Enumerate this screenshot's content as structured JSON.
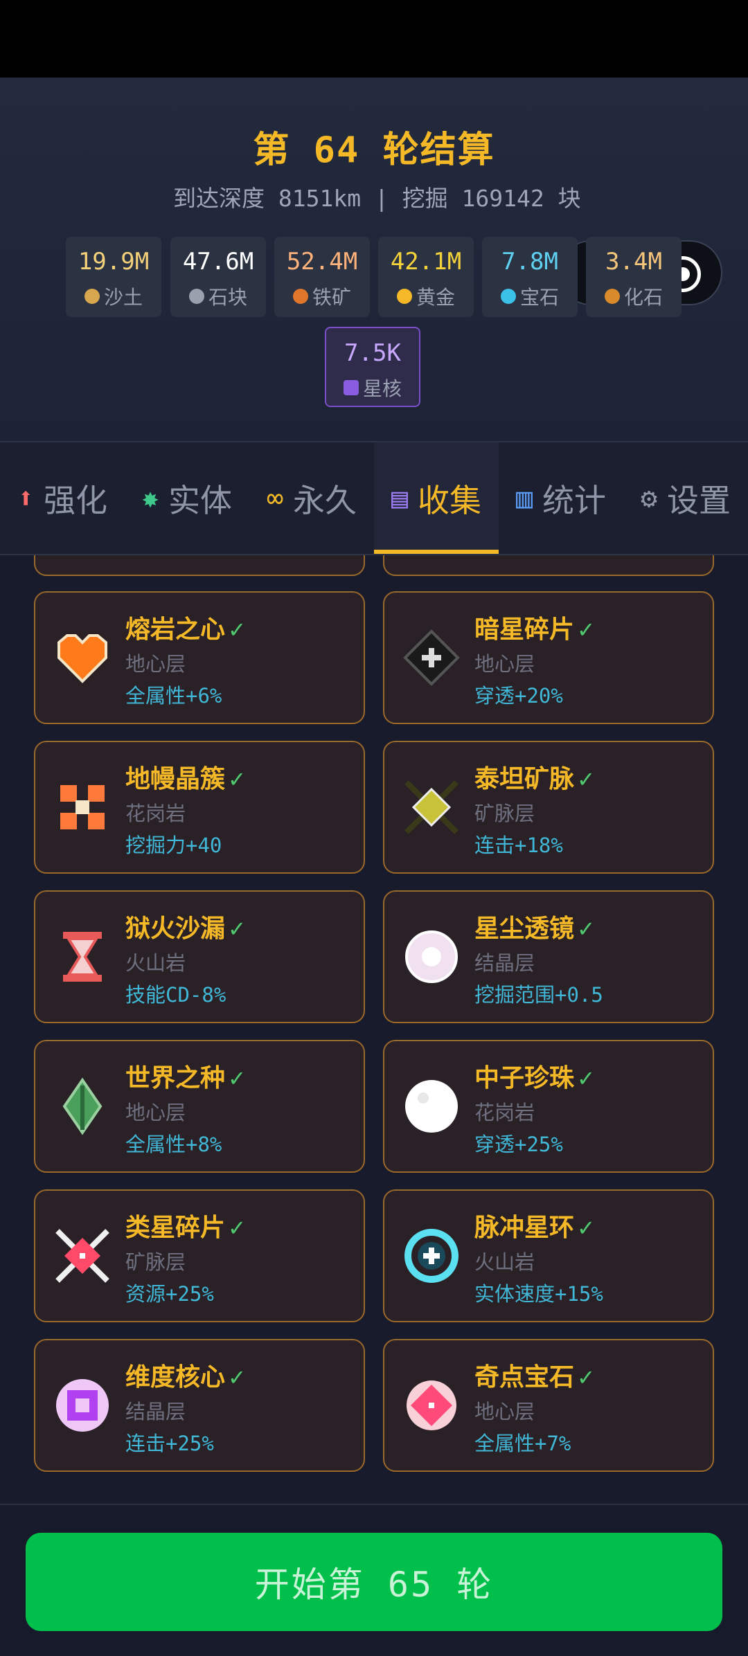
{
  "header": {
    "title": "第 64 轮结算",
    "subtitle": "到达深度 8151km | 挖掘 169142 块"
  },
  "resources": [
    {
      "value": "19.9M",
      "label": "沙土",
      "icon": "sand-icon",
      "color": "#f5d27a",
      "dot": "#d9a650"
    },
    {
      "value": "47.6M",
      "label": "石块",
      "icon": "stone-icon",
      "color": "#ffffff",
      "dot": "#9aa0ad"
    },
    {
      "value": "52.4M",
      "label": "铁矿",
      "icon": "iron-ore-icon",
      "color": "#ffb27a",
      "dot": "#e0762a"
    },
    {
      "value": "42.1M",
      "label": "黄金",
      "icon": "gold-icon",
      "color": "#f5d23a",
      "dot": "#f5b928"
    },
    {
      "value": "7.8M",
      "label": "宝石",
      "icon": "gem-icon",
      "color": "#5fd0f0",
      "dot": "#3bc0e8"
    },
    {
      "value": "3.4M",
      "label": "化石",
      "icon": "fossil-icon",
      "color": "#f5c57a",
      "dot": "#d98a2a"
    },
    {
      "value": "7.5K",
      "label": "星核",
      "icon": "star-core-icon",
      "color": "#c8a8ff",
      "dot": "#8a5ce0"
    }
  ],
  "tabs": [
    {
      "label": "强化",
      "icon": "upgrade-arrow-icon",
      "glyph": "⬆",
      "icon_color": "#ff6b6b",
      "active": false
    },
    {
      "label": "实体",
      "icon": "gear-green-icon",
      "glyph": "✸",
      "icon_color": "#3ec98a",
      "active": false
    },
    {
      "label": "永久",
      "icon": "infinity-icon",
      "glyph": "∞",
      "icon_color": "#f5b928",
      "active": false
    },
    {
      "label": "收集",
      "icon": "book-icon",
      "glyph": "▤",
      "icon_color": "#9a7cf0",
      "active": true
    },
    {
      "label": "统计",
      "icon": "bar-chart-icon",
      "glyph": "▥",
      "icon_color": "#5a9cf5",
      "active": false
    },
    {
      "label": "设置",
      "icon": "settings-icon",
      "glyph": "⚙",
      "icon_color": "#8f96a8",
      "active": false
    }
  ],
  "collection": [
    {
      "name": "熔岩之心",
      "layer": "地心层",
      "bonus": "全属性+6%",
      "icon": "lava-heart-icon",
      "color": "#ff7a1a"
    },
    {
      "name": "暗星碎片",
      "layer": "地心层",
      "bonus": "穿透+20%",
      "icon": "dark-star-shard-icon",
      "color": "#3a3a3a"
    },
    {
      "name": "地幔晶簇",
      "layer": "花岗岩",
      "bonus": "挖掘力+40",
      "icon": "mantle-crystal-icon",
      "color": "#ff7a3a"
    },
    {
      "name": "泰坦矿脉",
      "layer": "矿脉层",
      "bonus": "连击+18%",
      "icon": "titan-vein-icon",
      "color": "#c8c23a"
    },
    {
      "name": "狱火沙漏",
      "layer": "火山岩",
      "bonus": "技能CD-8%",
      "icon": "hellfire-hourglass-icon",
      "color": "#e85a5a"
    },
    {
      "name": "星尘透镜",
      "layer": "结晶层",
      "bonus": "挖掘范围+0.5",
      "icon": "stardust-lens-icon",
      "color": "#f0e0f0"
    },
    {
      "name": "世界之种",
      "layer": "地心层",
      "bonus": "全属性+8%",
      "icon": "world-seed-icon",
      "color": "#4aa05a"
    },
    {
      "name": "中子珍珠",
      "layer": "花岗岩",
      "bonus": "穿透+25%",
      "icon": "neutron-pearl-icon",
      "color": "#ffffff"
    },
    {
      "name": "类星碎片",
      "layer": "矿脉层",
      "bonus": "资源+25%",
      "icon": "quasar-shard-icon",
      "color": "#ff4a6a"
    },
    {
      "name": "脉冲星环",
      "layer": "火山岩",
      "bonus": "实体速度+15%",
      "icon": "pulsar-ring-icon",
      "color": "#5ae0f0"
    },
    {
      "name": "维度核心",
      "layer": "结晶层",
      "bonus": "连击+25%",
      "icon": "dimension-core-icon",
      "color": "#b040f0"
    },
    {
      "name": "奇点宝石",
      "layer": "地心层",
      "bonus": "全属性+7%",
      "icon": "singularity-gem-icon",
      "color": "#ff4a7a"
    }
  ],
  "check_mark": "✓",
  "start_button": "开始第 65 轮"
}
